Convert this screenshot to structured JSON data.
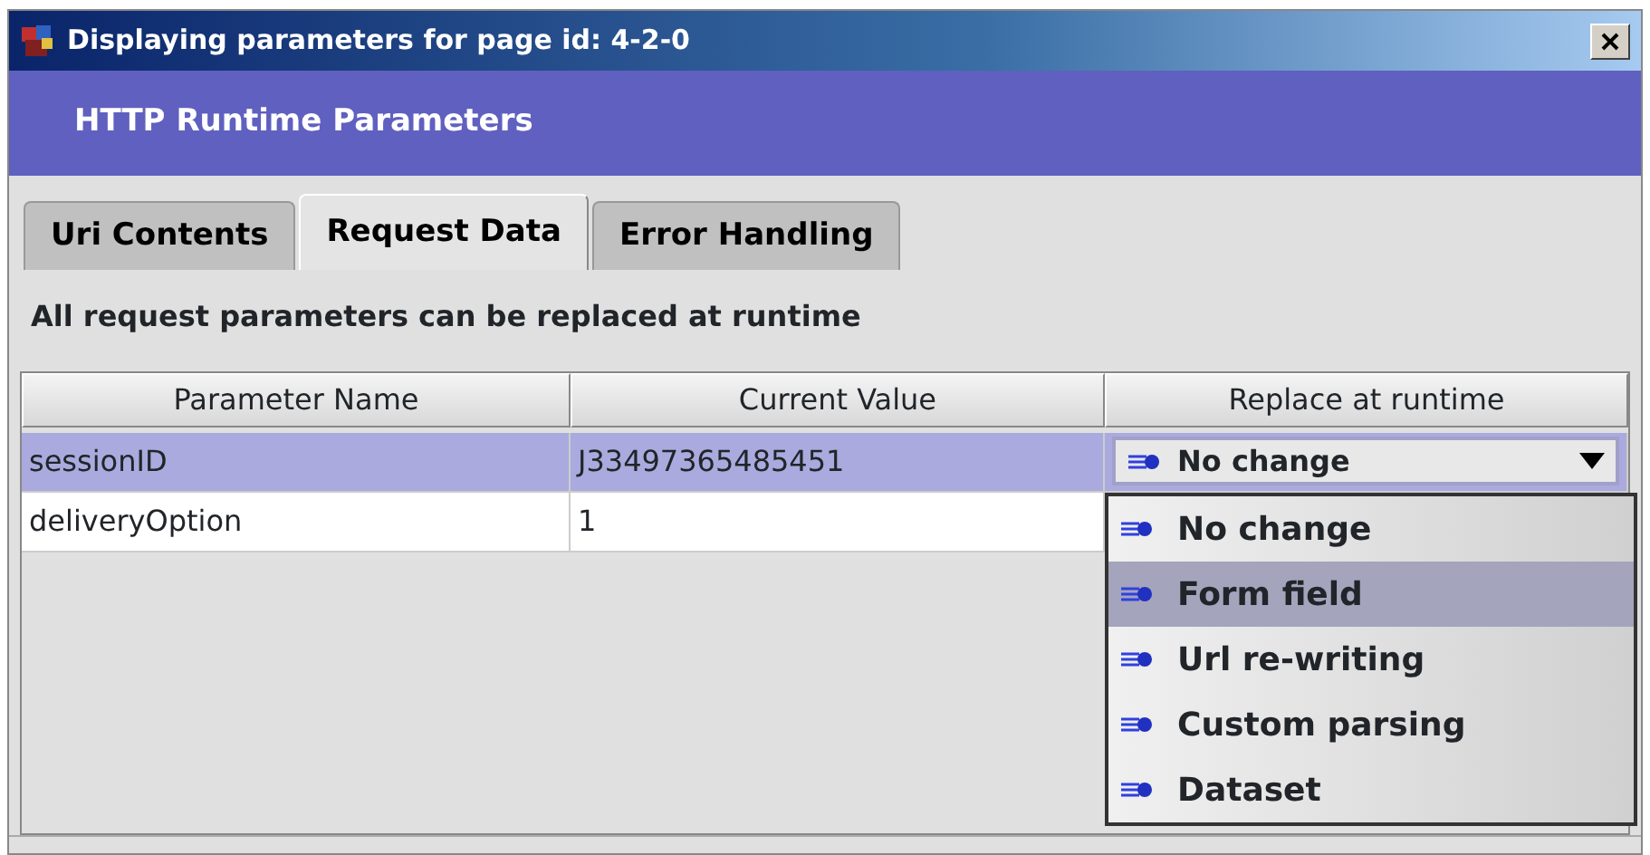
{
  "window": {
    "title": "Displaying parameters for page id: 4-2-0"
  },
  "header": {
    "title": "HTTP Runtime Parameters"
  },
  "tabs": [
    {
      "label": "Uri Contents",
      "selected": false
    },
    {
      "label": "Request Data",
      "selected": true
    },
    {
      "label": "Error Handling",
      "selected": false
    }
  ],
  "info": "All request parameters can be replaced at runtime",
  "table": {
    "columns": [
      "Parameter Name",
      "Current Value",
      "Replace at runtime"
    ],
    "rows": [
      {
        "name": "sessionID",
        "value": "J33497365485451",
        "replace": "No change",
        "selected": true
      },
      {
        "name": "deliveryOption",
        "value": "1",
        "selected": false
      }
    ]
  },
  "dropdown": {
    "expanded": true,
    "options": [
      {
        "label": "No change",
        "selected": false
      },
      {
        "label": "Form field",
        "selected": true
      },
      {
        "label": "Url re-writing",
        "selected": false
      },
      {
        "label": "Custom parsing",
        "selected": false
      },
      {
        "label": "Dataset",
        "selected": false
      }
    ]
  }
}
